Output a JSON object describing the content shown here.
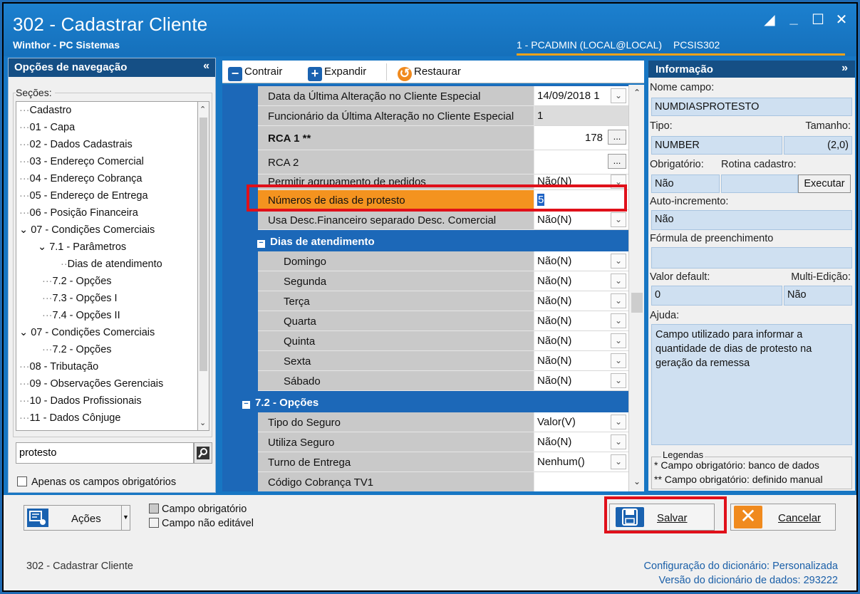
{
  "window": {
    "title": "302 - Cadastrar Cliente",
    "subtitle": "Winthor - PC Sistemas",
    "user": "1 - PCADMIN (LOCAL@LOCAL)",
    "routine": "PCSIS302"
  },
  "nav": {
    "header": "Opções de navegação",
    "sections_label": "Seções:",
    "items": [
      "Cadastro",
      "01 - Capa",
      "02 - Dados Cadastrais",
      "03 - Endereço Comercial",
      "04 - Endereço Cobrança",
      "05 - Endereço de Entrega",
      "06 - Posição Financeira",
      "07 - Condições Comerciais",
      "7.1 - Parâmetros",
      "Dias de atendimento",
      "7.2 - Opções",
      "7.3 - Opções I",
      "7.4 - Opções II",
      "07 - Condições Comerciais",
      "7.2 - Opções",
      "08 - Tributação",
      "09 - Observações Gerenciais",
      "10 - Dados Profissionais",
      "11 - Dados Cônjuge"
    ],
    "search_value": "protesto",
    "required_only_label": "Apenas os campos obrigatórios"
  },
  "toolbar": {
    "collapse_label": "Contrair",
    "expand_label": "Expandir",
    "restore_label": "Restaurar"
  },
  "grid": {
    "rows_top": [
      {
        "label": "Data da Última Alteração no Cliente Especial",
        "value": "14/09/2018 1"
      },
      {
        "label": "Funcionário da Última Alteração no Cliente Especial",
        "value": "1"
      },
      {
        "label": "RCA 1 **",
        "value": "178"
      },
      {
        "label": "RCA 2",
        "value": ""
      },
      {
        "label": "Permitir agrupamento de pedidos",
        "value": "Não(N)"
      },
      {
        "label": "Números de dias de protesto",
        "value": "5"
      },
      {
        "label": "Usa Desc.Financeiro separado Desc. Comercial",
        "value": "Não(N)"
      }
    ],
    "group_days": "Dias de atendimento",
    "days": [
      {
        "label": "Domingo",
        "value": "Não(N)"
      },
      {
        "label": "Segunda",
        "value": "Não(N)"
      },
      {
        "label": "Terça",
        "value": "Não(N)"
      },
      {
        "label": "Quarta",
        "value": "Não(N)"
      },
      {
        "label": "Quinta",
        "value": "Não(N)"
      },
      {
        "label": "Sexta",
        "value": "Não(N)"
      },
      {
        "label": "Sábado",
        "value": "Não(N)"
      }
    ],
    "group_options": "7.2 - Opções",
    "options": [
      {
        "label": "Tipo do Seguro",
        "value": "Valor(V)"
      },
      {
        "label": "Utiliza Seguro",
        "value": "Não(N)"
      },
      {
        "label": "Turno de Entrega",
        "value": "Nenhum()"
      },
      {
        "label": "Código Cobrança TV1",
        "value": ""
      }
    ]
  },
  "info": {
    "header": "Informação",
    "field_name_label": "Nome campo:",
    "field_name": "NUMDIASPROTESTO",
    "type_label": "Tipo:",
    "size_label": "Tamanho:",
    "type": "NUMBER",
    "size": "(2,0)",
    "required_label": "Obrigatório:",
    "routine_label": "Rotina cadastro:",
    "required": "Não",
    "execute_label": "Executar",
    "autoinc_label": "Auto-incremento:",
    "autoinc": "Não",
    "formula_label": "Fórmula de preenchimento",
    "formula": "",
    "default_label": "Valor default:",
    "multiedit_label": "Multi-Edição:",
    "default": "0",
    "multiedit": "Não",
    "help_label": "Ajuda:",
    "help": "Campo utilizado para informar a quantidade de dias de protesto na geração da remessa",
    "legend_title": "Legendas",
    "legend_1": "* Campo obrigatório: banco de dados",
    "legend_2": "** Campo obrigatório: definido manual"
  },
  "bottom": {
    "actions_label": "Ações",
    "legend_required": "Campo obrigatório",
    "legend_not_editable": "Campo não editável",
    "save_label": "Salvar",
    "cancel_label": "Cancelar",
    "footer_title": "302 - Cadastrar Cliente",
    "dict_config_label": "Configuração do dicionário:",
    "dict_config_value": "Personalizada",
    "dict_version_label": "Versão do dicionário de dados:",
    "dict_version_value": "293222"
  },
  "colors": {
    "titlebar": "#1776c3",
    "panel_header": "#154f85",
    "highlight": "#f4931f",
    "annotation": "#e0101a"
  }
}
